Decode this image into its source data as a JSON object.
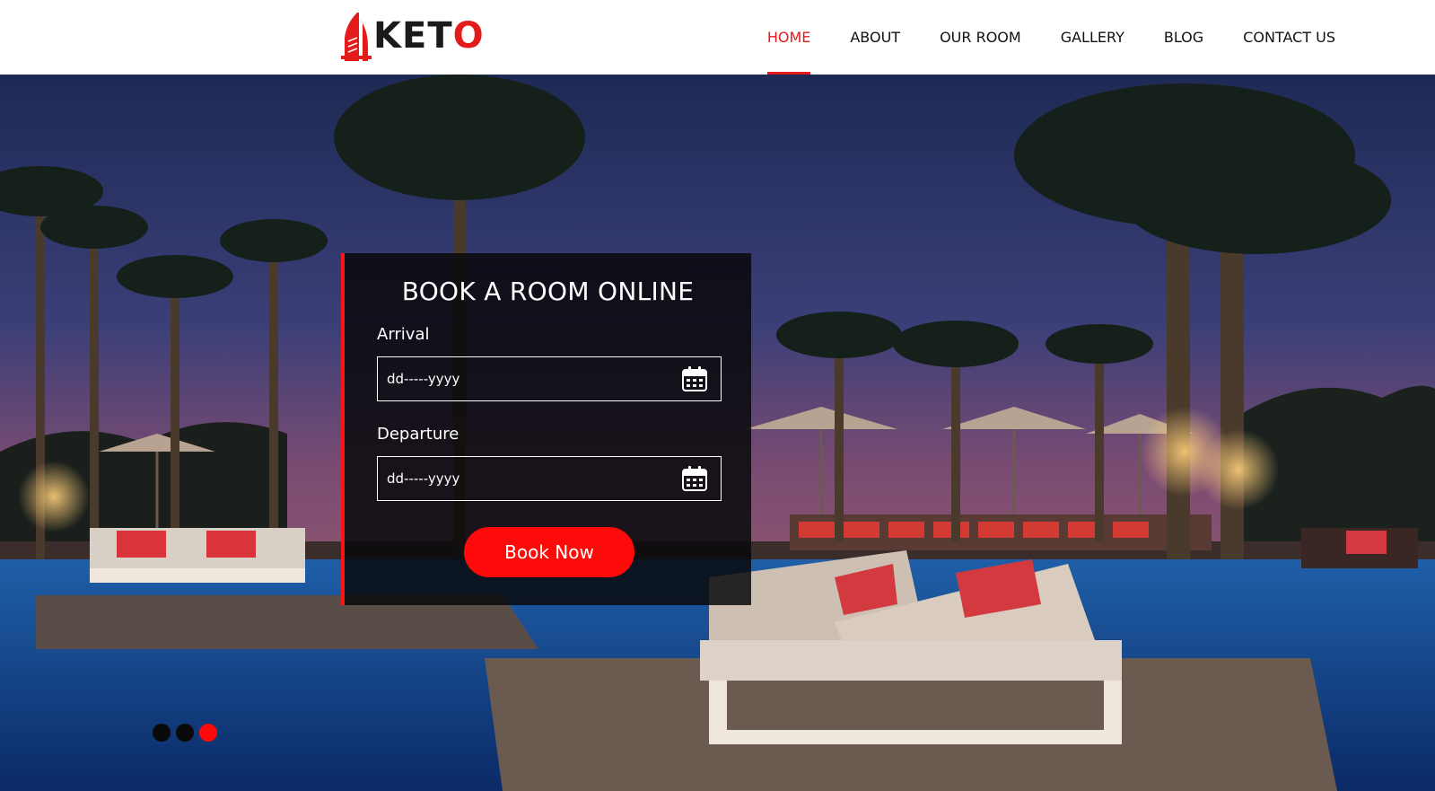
{
  "brand": {
    "name_prefix": "KET",
    "name_last": "O",
    "accent": "#e31b1b"
  },
  "nav": {
    "items": [
      {
        "label": "HOME",
        "active": true
      },
      {
        "label": "ABOUT",
        "active": false
      },
      {
        "label": "OUR ROOM",
        "active": false
      },
      {
        "label": "GALLERY",
        "active": false
      },
      {
        "label": "BLOG",
        "active": false
      },
      {
        "label": "CONTACT US",
        "active": false
      }
    ]
  },
  "booking": {
    "title": "BOOK A ROOM ONLINE",
    "arrival_label": "Arrival",
    "arrival_placeholder": "dd-----yyyy",
    "departure_label": "Departure",
    "departure_placeholder": "dd-----yyyy",
    "button_label": "Book Now",
    "calendar_icon": "calendar-icon"
  },
  "carousel": {
    "slide_count": 3,
    "active_index": 2
  },
  "colors": {
    "accent": "#ff0a0a",
    "header_bg": "#ffffff",
    "panel_bg": "#0a0a0c"
  }
}
